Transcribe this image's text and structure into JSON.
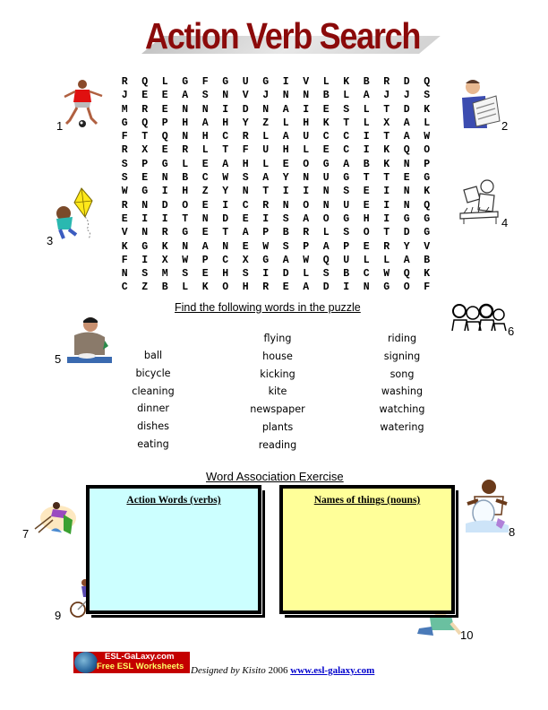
{
  "title": "Action Verb Search",
  "colors": {
    "title": "#8b0a0a",
    "verbs_box": "#ccffff",
    "nouns_box": "#ffff99",
    "link": "#0000cc"
  },
  "puzzle": {
    "rows": [
      [
        "R",
        "Q",
        "L",
        "G",
        "F",
        "G",
        "U",
        "G",
        "I",
        "V",
        "L",
        "K",
        "B",
        "R",
        "D",
        "Q"
      ],
      [
        "J",
        "E",
        "E",
        "A",
        "S",
        "N",
        "V",
        "J",
        "N",
        "N",
        "B",
        "L",
        "A",
        "J",
        "J",
        "S"
      ],
      [
        "M",
        "R",
        "E",
        "N",
        "N",
        "I",
        "D",
        "N",
        "A",
        "I",
        "E",
        "S",
        "L",
        "T",
        "D",
        "K"
      ],
      [
        "G",
        "Q",
        "P",
        "H",
        "A",
        "H",
        "Y",
        "Z",
        "L",
        "H",
        "K",
        "T",
        "L",
        "X",
        "A",
        "L"
      ],
      [
        "F",
        "T",
        "Q",
        "N",
        "H",
        "C",
        "R",
        "L",
        "A",
        "U",
        "C",
        "C",
        "I",
        "T",
        "A",
        "W"
      ],
      [
        "R",
        "X",
        "E",
        "R",
        "L",
        "T",
        "F",
        "U",
        "H",
        "L",
        "E",
        "C",
        "I",
        "K",
        "Q",
        "O"
      ],
      [
        "S",
        "P",
        "G",
        "L",
        "E",
        "A",
        "H",
        "L",
        "E",
        "O",
        "G",
        "A",
        "B",
        "K",
        "N",
        "P"
      ],
      [
        "S",
        "E",
        "N",
        "B",
        "C",
        "W",
        "S",
        "A",
        "Y",
        "N",
        "U",
        "G",
        "T",
        "T",
        "E",
        "G"
      ],
      [
        "W",
        "G",
        "I",
        "H",
        "Z",
        "Y",
        "N",
        "T",
        "I",
        "I",
        "N",
        "S",
        "E",
        "I",
        "N",
        "K"
      ],
      [
        "R",
        "N",
        "D",
        "O",
        "E",
        "I",
        "C",
        "R",
        "N",
        "O",
        "N",
        "U",
        "E",
        "I",
        "N",
        "Q"
      ],
      [
        "E",
        "I",
        "I",
        "T",
        "N",
        "D",
        "E",
        "I",
        "S",
        "A",
        "O",
        "G",
        "H",
        "I",
        "G",
        "G"
      ],
      [
        "V",
        "N",
        "R",
        "G",
        "E",
        "T",
        "A",
        "P",
        "B",
        "R",
        "L",
        "S",
        "O",
        "T",
        "D",
        "G"
      ],
      [
        "K",
        "G",
        "K",
        "N",
        "A",
        "N",
        "E",
        "W",
        "S",
        "P",
        "A",
        "P",
        "E",
        "R",
        "Y",
        "V"
      ],
      [
        "F",
        "I",
        "X",
        "W",
        "P",
        "C",
        "X",
        "G",
        "A",
        "W",
        "Q",
        "U",
        "L",
        "L",
        "A",
        "B"
      ],
      [
        "N",
        "S",
        "M",
        "S",
        "E",
        "H",
        "S",
        "I",
        "D",
        "L",
        "S",
        "B",
        "C",
        "W",
        "Q",
        "K"
      ],
      [
        "C",
        "Z",
        "B",
        "L",
        "K",
        "O",
        "H",
        "R",
        "E",
        "A",
        "D",
        "I",
        "N",
        "G",
        "O",
        "F"
      ]
    ]
  },
  "pictures": [
    {
      "number": "1",
      "icon": "soccer-player-kicking-icon"
    },
    {
      "number": "2",
      "icon": "man-reading-newspaper-icon"
    },
    {
      "number": "3",
      "icon": "boy-flying-kite-icon"
    },
    {
      "number": "4",
      "icon": "watering-plants-icon"
    },
    {
      "number": "5",
      "icon": "man-eating-dinner-icon"
    },
    {
      "number": "6",
      "icon": "people-singing-icon"
    },
    {
      "number": "7",
      "icon": "woman-cleaning-icon"
    },
    {
      "number": "8",
      "icon": "boy-washing-dishes-icon"
    },
    {
      "number": "9",
      "icon": "riding-bicycle-icon"
    },
    {
      "number": "10",
      "icon": "child-watching-tv-icon"
    }
  ],
  "word_list": {
    "heading": "Find the following words in the puzzle",
    "columns": [
      [
        "ball",
        "bicycle",
        "cleaning",
        "dinner",
        "dishes",
        "eating"
      ],
      [
        "flying",
        "house",
        "kicking",
        "kite",
        "newspaper",
        "plants",
        "reading"
      ],
      [
        "riding",
        "signing",
        "song",
        "washing",
        "watching",
        "watering"
      ]
    ]
  },
  "association": {
    "heading": "Word Association Exercise",
    "verbs_label": "Action Words (verbs)",
    "nouns_label": "Names of things (nouns)"
  },
  "footer": {
    "logo_line1": "ESL-GaLaxy.com",
    "logo_line2": "Free ESL Worksheets",
    "designed_by": "Designed by Kisito",
    "year": " 2006 ",
    "link_text": "www.esl-galaxy.com"
  }
}
